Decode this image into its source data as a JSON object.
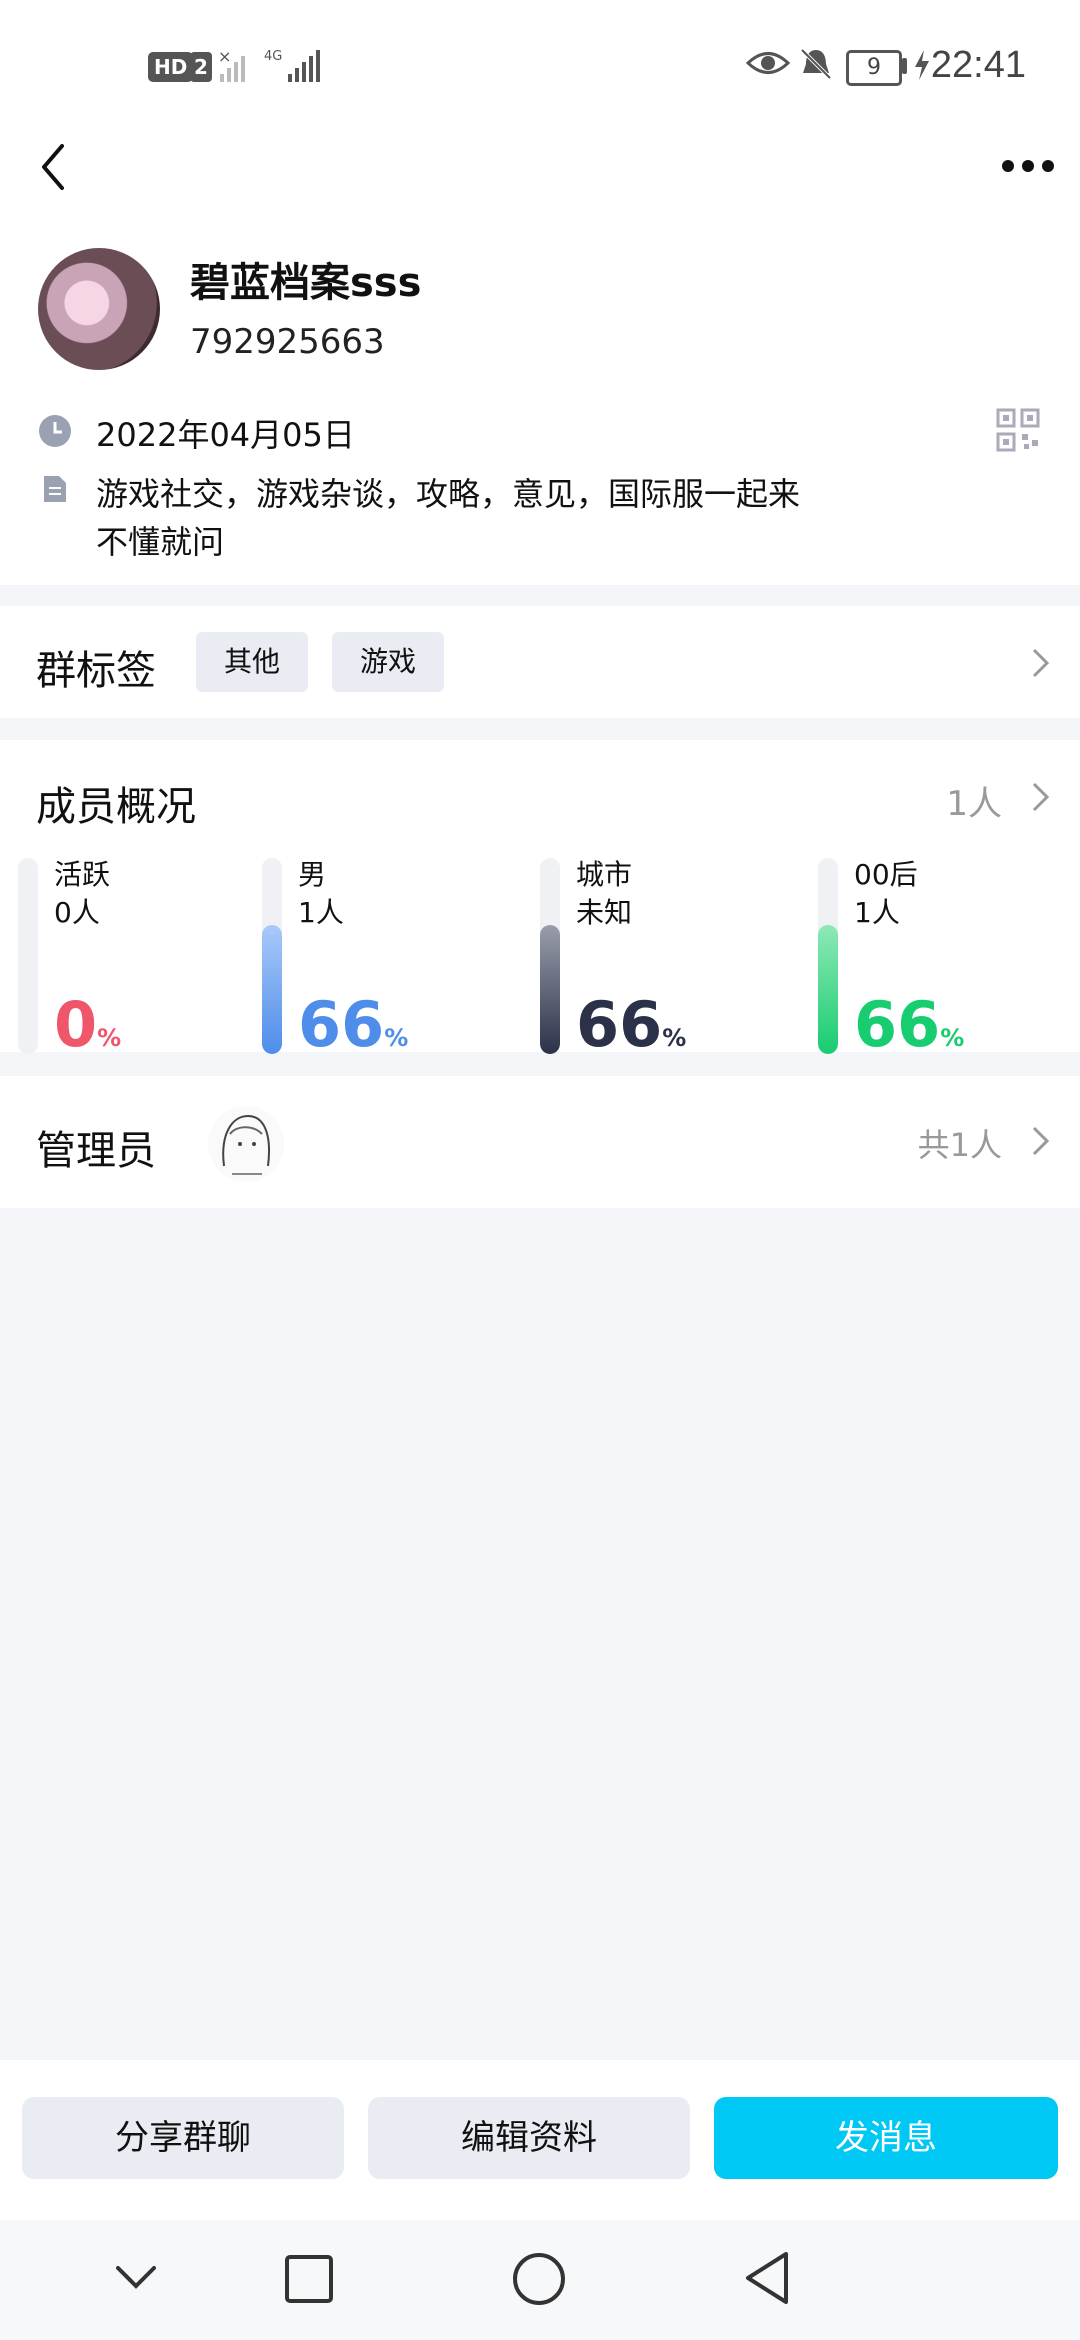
{
  "status": {
    "hd": "HD",
    "sim": "2",
    "network": "4G",
    "battery": "9",
    "time": "22:41"
  },
  "group": {
    "name": "碧蓝档案sss",
    "id": "792925663",
    "date": "2022年04月05日",
    "desc_line1": "游戏社交，游戏杂谈，攻略，意见，国际服一起来",
    "desc_line2": "不懂就问"
  },
  "tags": {
    "title": "群标签",
    "items": [
      "其他",
      "游戏"
    ]
  },
  "members": {
    "title": "成员概况",
    "count": "1人",
    "stats": [
      {
        "label": "活跃",
        "value": "0人",
        "pct": "0",
        "fill": 0.0,
        "color": "#f0566a"
      },
      {
        "label": "男",
        "value": "1人",
        "pct": "66",
        "fill": 0.66,
        "color": "#4e8de9"
      },
      {
        "label": "城市",
        "value": "未知",
        "pct": "66",
        "fill": 0.66,
        "color": "#2b3148"
      },
      {
        "label": "00后",
        "value": "1人",
        "pct": "66",
        "fill": 0.66,
        "color": "#18cc70"
      }
    ],
    "pct_sign": "%"
  },
  "admins": {
    "title": "管理员",
    "count": "共1人"
  },
  "buttons": {
    "share": "分享群聊",
    "edit": "编辑资料",
    "send": "发消息"
  }
}
